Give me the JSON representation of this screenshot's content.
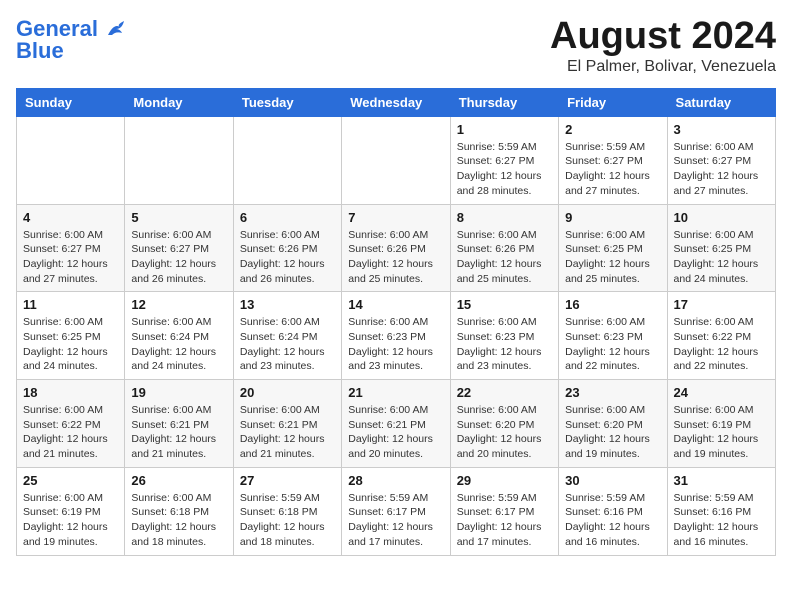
{
  "logo": {
    "line1": "General",
    "line2": "Blue"
  },
  "title": {
    "month_year": "August 2024",
    "location": "El Palmer, Bolivar, Venezuela"
  },
  "days_of_week": [
    "Sunday",
    "Monday",
    "Tuesday",
    "Wednesday",
    "Thursday",
    "Friday",
    "Saturday"
  ],
  "weeks": [
    [
      {
        "day": "",
        "info": ""
      },
      {
        "day": "",
        "info": ""
      },
      {
        "day": "",
        "info": ""
      },
      {
        "day": "",
        "info": ""
      },
      {
        "day": "1",
        "info": "Sunrise: 5:59 AM\nSunset: 6:27 PM\nDaylight: 12 hours\nand 28 minutes."
      },
      {
        "day": "2",
        "info": "Sunrise: 5:59 AM\nSunset: 6:27 PM\nDaylight: 12 hours\nand 27 minutes."
      },
      {
        "day": "3",
        "info": "Sunrise: 6:00 AM\nSunset: 6:27 PM\nDaylight: 12 hours\nand 27 minutes."
      }
    ],
    [
      {
        "day": "4",
        "info": "Sunrise: 6:00 AM\nSunset: 6:27 PM\nDaylight: 12 hours\nand 27 minutes."
      },
      {
        "day": "5",
        "info": "Sunrise: 6:00 AM\nSunset: 6:27 PM\nDaylight: 12 hours\nand 26 minutes."
      },
      {
        "day": "6",
        "info": "Sunrise: 6:00 AM\nSunset: 6:26 PM\nDaylight: 12 hours\nand 26 minutes."
      },
      {
        "day": "7",
        "info": "Sunrise: 6:00 AM\nSunset: 6:26 PM\nDaylight: 12 hours\nand 25 minutes."
      },
      {
        "day": "8",
        "info": "Sunrise: 6:00 AM\nSunset: 6:26 PM\nDaylight: 12 hours\nand 25 minutes."
      },
      {
        "day": "9",
        "info": "Sunrise: 6:00 AM\nSunset: 6:25 PM\nDaylight: 12 hours\nand 25 minutes."
      },
      {
        "day": "10",
        "info": "Sunrise: 6:00 AM\nSunset: 6:25 PM\nDaylight: 12 hours\nand 24 minutes."
      }
    ],
    [
      {
        "day": "11",
        "info": "Sunrise: 6:00 AM\nSunset: 6:25 PM\nDaylight: 12 hours\nand 24 minutes."
      },
      {
        "day": "12",
        "info": "Sunrise: 6:00 AM\nSunset: 6:24 PM\nDaylight: 12 hours\nand 24 minutes."
      },
      {
        "day": "13",
        "info": "Sunrise: 6:00 AM\nSunset: 6:24 PM\nDaylight: 12 hours\nand 23 minutes."
      },
      {
        "day": "14",
        "info": "Sunrise: 6:00 AM\nSunset: 6:23 PM\nDaylight: 12 hours\nand 23 minutes."
      },
      {
        "day": "15",
        "info": "Sunrise: 6:00 AM\nSunset: 6:23 PM\nDaylight: 12 hours\nand 23 minutes."
      },
      {
        "day": "16",
        "info": "Sunrise: 6:00 AM\nSunset: 6:23 PM\nDaylight: 12 hours\nand 22 minutes."
      },
      {
        "day": "17",
        "info": "Sunrise: 6:00 AM\nSunset: 6:22 PM\nDaylight: 12 hours\nand 22 minutes."
      }
    ],
    [
      {
        "day": "18",
        "info": "Sunrise: 6:00 AM\nSunset: 6:22 PM\nDaylight: 12 hours\nand 21 minutes."
      },
      {
        "day": "19",
        "info": "Sunrise: 6:00 AM\nSunset: 6:21 PM\nDaylight: 12 hours\nand 21 minutes."
      },
      {
        "day": "20",
        "info": "Sunrise: 6:00 AM\nSunset: 6:21 PM\nDaylight: 12 hours\nand 21 minutes."
      },
      {
        "day": "21",
        "info": "Sunrise: 6:00 AM\nSunset: 6:21 PM\nDaylight: 12 hours\nand 20 minutes."
      },
      {
        "day": "22",
        "info": "Sunrise: 6:00 AM\nSunset: 6:20 PM\nDaylight: 12 hours\nand 20 minutes."
      },
      {
        "day": "23",
        "info": "Sunrise: 6:00 AM\nSunset: 6:20 PM\nDaylight: 12 hours\nand 19 minutes."
      },
      {
        "day": "24",
        "info": "Sunrise: 6:00 AM\nSunset: 6:19 PM\nDaylight: 12 hours\nand 19 minutes."
      }
    ],
    [
      {
        "day": "25",
        "info": "Sunrise: 6:00 AM\nSunset: 6:19 PM\nDaylight: 12 hours\nand 19 minutes."
      },
      {
        "day": "26",
        "info": "Sunrise: 6:00 AM\nSunset: 6:18 PM\nDaylight: 12 hours\nand 18 minutes."
      },
      {
        "day": "27",
        "info": "Sunrise: 5:59 AM\nSunset: 6:18 PM\nDaylight: 12 hours\nand 18 minutes."
      },
      {
        "day": "28",
        "info": "Sunrise: 5:59 AM\nSunset: 6:17 PM\nDaylight: 12 hours\nand 17 minutes."
      },
      {
        "day": "29",
        "info": "Sunrise: 5:59 AM\nSunset: 6:17 PM\nDaylight: 12 hours\nand 17 minutes."
      },
      {
        "day": "30",
        "info": "Sunrise: 5:59 AM\nSunset: 6:16 PM\nDaylight: 12 hours\nand 16 minutes."
      },
      {
        "day": "31",
        "info": "Sunrise: 5:59 AM\nSunset: 6:16 PM\nDaylight: 12 hours\nand 16 minutes."
      }
    ]
  ]
}
